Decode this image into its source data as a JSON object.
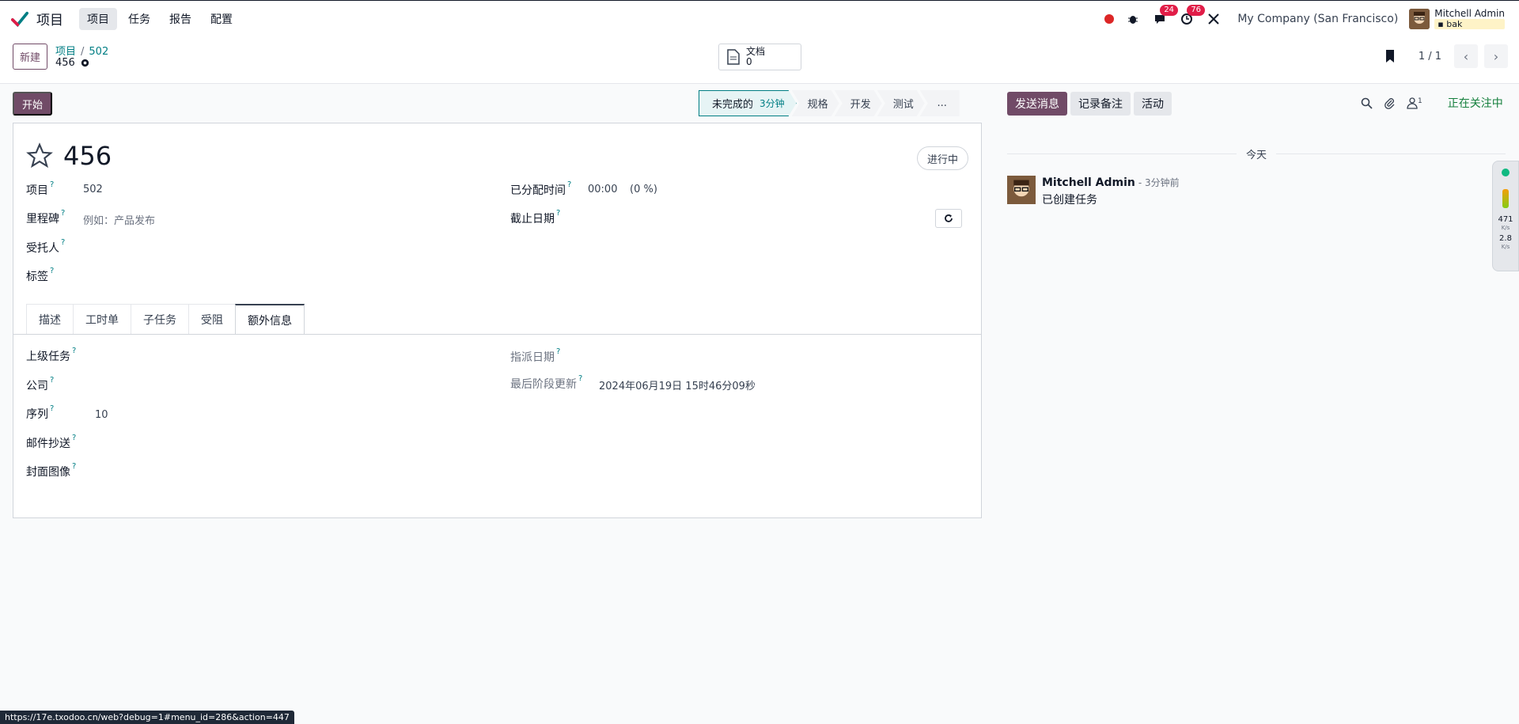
{
  "navbar": {
    "app_name": "项目",
    "menus": [
      "项目",
      "任务",
      "报告",
      "配置"
    ],
    "chat_badge": "24",
    "activity_badge": "76",
    "company": "My Company (San Francisco)",
    "user_name": "Mitchell Admin",
    "db_name": "bak"
  },
  "control": {
    "new_label": "新建",
    "breadcrumb_parent": "项目",
    "breadcrumb_project": "502",
    "record_name": "456",
    "doc_label": "文档",
    "doc_count": "0",
    "pager_value": "1 / 1"
  },
  "statusbar": {
    "start_label": "开始",
    "current_stage": "未完成的",
    "current_duration": "3分钟",
    "stages": [
      "规格",
      "开发",
      "测试"
    ],
    "more": "..."
  },
  "form": {
    "title": "456",
    "state_label": "进行中",
    "project_label": "项目",
    "project_value": "502",
    "milestone_label": "里程碑",
    "milestone_placeholder": "例如：产品发布",
    "assignees_label": "受托人",
    "tags_label": "标签",
    "allocated_label": "已分配时间",
    "allocated_value": "00:00",
    "allocated_pct": "(0 %)",
    "deadline_label": "截止日期",
    "question_mark": "?",
    "tabs": [
      "描述",
      "工时单",
      "子任务",
      "受阻",
      "额外信息"
    ],
    "active_tab": "额外信息",
    "parent_task_label": "上级任务",
    "company_label": "公司",
    "sequence_label": "序列",
    "sequence_value": "10",
    "email_cc_label": "邮件抄送",
    "cover_image_label": "封面图像",
    "assign_date_label": "指派日期",
    "last_stage_update_label": "最后阶段更新",
    "last_stage_update_value": "2024年06月19日 15时46分09秒"
  },
  "chatter": {
    "send_message": "发送消息",
    "log_note": "记录备注",
    "activity": "活动",
    "followers_count": "1",
    "following": "正在关注中",
    "today": "今天",
    "author": "Mitchell Admin",
    "time": "- 3分钟前",
    "body": "已创建任务"
  },
  "widget": {
    "upload": "471",
    "upload_unit": "K/s",
    "download": "2.8",
    "download_unit": "K/s"
  },
  "status_url": "https://17e.txodoo.cn/web?debug=1#menu_id=286&action=447",
  "colors": {
    "brand": "#714b67",
    "accent": "#017e84",
    "following": "#15803d",
    "badge": "#e11d48"
  }
}
